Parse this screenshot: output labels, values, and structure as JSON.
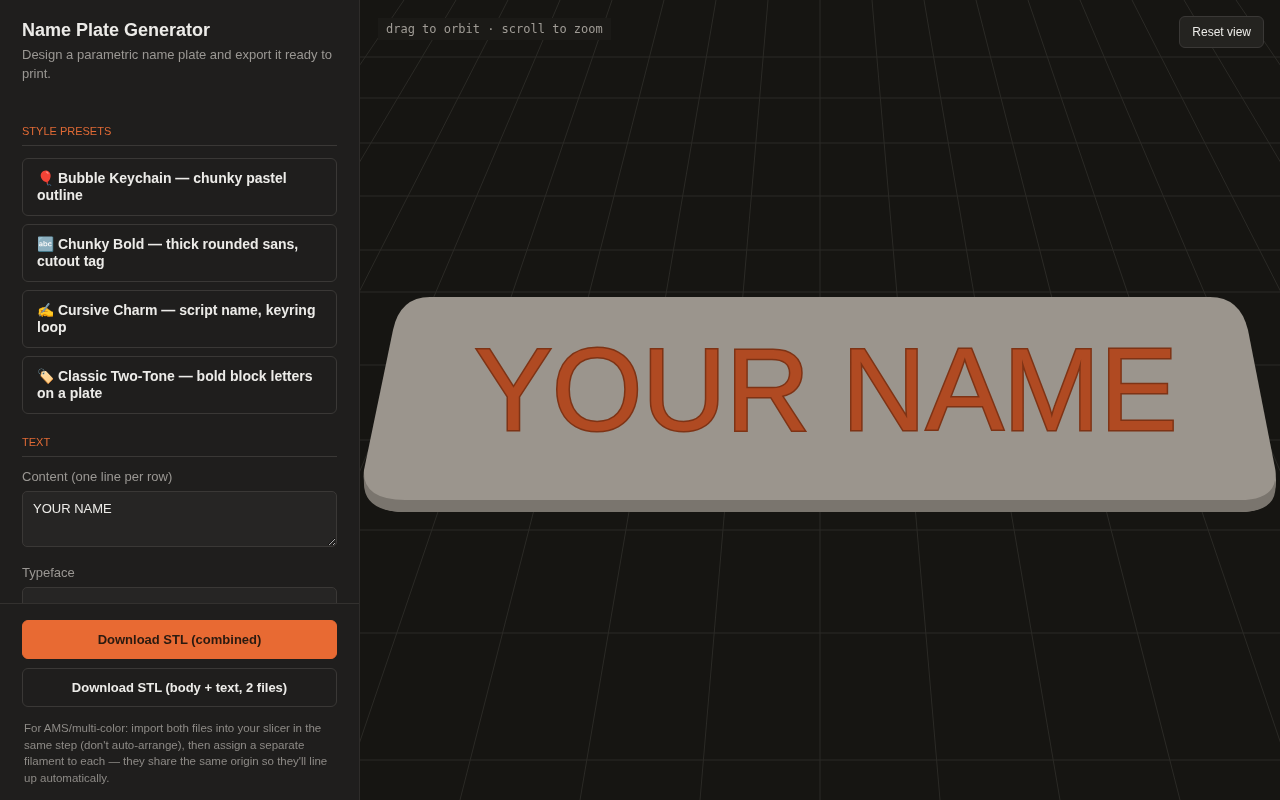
{
  "sidebar": {
    "title": "Name Plate Generator",
    "subtitle": "Design a parametric name plate and export it ready to print.",
    "sections": [
      {
        "heading": "STYLE PRESETS",
        "kind": "presets",
        "presets": [
          {
            "emoji": "🎈",
            "label": "Bubble Keychain — chunky pastel outline"
          },
          {
            "emoji": "🔤",
            "label": "Chunky Bold — thick rounded sans, cutout tag"
          },
          {
            "emoji": "✍️",
            "label": "Cursive Charm — script name, keyring loop"
          },
          {
            "emoji": "🏷️",
            "label": "Classic Two-Tone — bold block letters on a plate"
          }
        ]
      },
      {
        "heading": "TEXT",
        "kind": "fields",
        "fields": [
          {
            "kind": "textarea",
            "label": "Content (one line per row)",
            "value": "YOUR NAME"
          },
          {
            "kind": "select",
            "label": "Typeface"
          }
        ]
      }
    ]
  },
  "footer": {
    "buttons": [
      {
        "label": "Download STL (combined)",
        "kind": "primary"
      },
      {
        "label": "Download STL (body + text, 2 files)",
        "kind": "secondary"
      }
    ],
    "note": "For AMS/multi-color: import both files into your slicer in the same step (don't auto-arrange), then assign a separate filament to each — they share the same origin so they'll line up automatically."
  },
  "viewport": {
    "hint": "drag to orbit · scroll to zoom",
    "reset_button": "Reset view",
    "model_text": "YOUR NAME"
  }
}
